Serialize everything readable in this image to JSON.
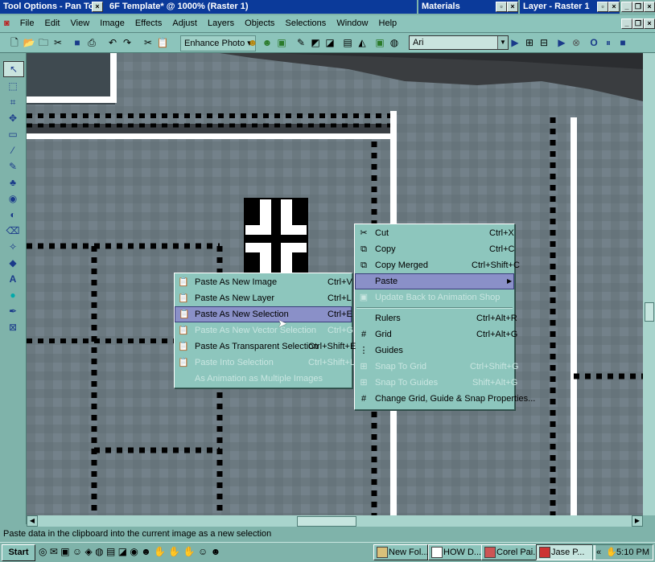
{
  "windows": {
    "tool_options_title": "Tool Options - Pan Tool",
    "document_title": "6F Template* @ 1000% (Raster 1)",
    "materials_title": "Materials",
    "layer_title": "Layer - Raster 1"
  },
  "menubar": {
    "items": [
      "File",
      "Edit",
      "View",
      "Image",
      "Effects",
      "Adjust",
      "Layers",
      "Objects",
      "Selections",
      "Window",
      "Help"
    ]
  },
  "toolbar": {
    "enhance_label": "Enhance Photo ▾",
    "font_value": "Ari"
  },
  "context_menu_main": {
    "items": [
      {
        "label": "Cut",
        "shortcut": "Ctrl+X",
        "icon": "scissors-icon",
        "disabled": false
      },
      {
        "label": "Copy",
        "shortcut": "Ctrl+C",
        "icon": "copy-icon",
        "disabled": false
      },
      {
        "label": "Copy Merged",
        "shortcut": "Ctrl+Shift+C",
        "icon": "copy-merged-icon",
        "disabled": false
      },
      {
        "label": "Paste",
        "shortcut": "",
        "icon": "",
        "disabled": false,
        "submenu": true
      },
      {
        "label": "Update Back to Animation Shop",
        "shortcut": "",
        "icon": "animation-icon",
        "disabled": true
      },
      {
        "label": "Rulers",
        "shortcut": "Ctrl+Alt+R",
        "icon": "",
        "disabled": false
      },
      {
        "label": "Grid",
        "shortcut": "Ctrl+Alt+G",
        "icon": "grid-icon",
        "disabled": false
      },
      {
        "label": "Guides",
        "shortcut": "",
        "icon": "guides-icon",
        "disabled": false
      },
      {
        "label": "Snap To Grid",
        "shortcut": "Ctrl+Shift+G",
        "icon": "snap-grid-icon",
        "disabled": true
      },
      {
        "label": "Snap To Guides",
        "shortcut": "Shift+Alt+G",
        "icon": "snap-guides-icon",
        "disabled": true
      },
      {
        "label": "Change Grid, Guide & Snap Properties...",
        "shortcut": "",
        "icon": "grid-props-icon",
        "disabled": false
      }
    ]
  },
  "paste_submenu": {
    "items": [
      {
        "label": "Paste As New Image",
        "shortcut": "Ctrl+V",
        "disabled": false
      },
      {
        "label": "Paste As New Layer",
        "shortcut": "Ctrl+L",
        "disabled": false
      },
      {
        "label": "Paste As New Selection",
        "shortcut": "Ctrl+E",
        "disabled": false
      },
      {
        "label": "Paste As New Vector Selection",
        "shortcut": "Ctrl+G",
        "disabled": true
      },
      {
        "label": "Paste As Transparent Selection",
        "shortcut": "Ctrl+Shift+E",
        "disabled": false
      },
      {
        "label": "Paste Into Selection",
        "shortcut": "Ctrl+Shift+L",
        "disabled": true
      },
      {
        "label": "As Animation as Multiple Images",
        "shortcut": "",
        "disabled": true
      }
    ]
  },
  "status": {
    "text": "Paste data in the clipboard into the current image as a new selection"
  },
  "taskbar": {
    "start_label": "Start",
    "tasks": [
      "New Fol...",
      "HOW D...",
      "Corel Pai...",
      "Jase P..."
    ],
    "clock": "5:10 PM"
  },
  "colors": {
    "titlebar": "#0b3a9a",
    "chrome": "#7fb3aa",
    "menu_bg": "#8dc6bd",
    "highlight": "#8a90c8"
  }
}
